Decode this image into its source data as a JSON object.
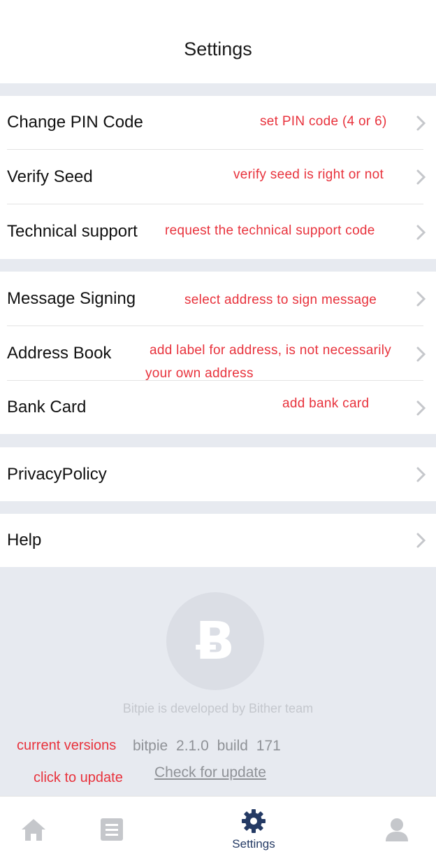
{
  "header": {
    "title": "Settings"
  },
  "groups": [
    {
      "rows": [
        {
          "label": "Change PIN Code",
          "hint": "set PIN code (4 or 6)"
        },
        {
          "label": "Verify Seed",
          "hint": "verify seed is right or not"
        },
        {
          "label": "Technical support",
          "hint": "request the technical support code"
        }
      ]
    },
    {
      "rows": [
        {
          "label": "Message Signing",
          "hint": "select address to sign message"
        },
        {
          "label": "Address Book",
          "hint": "add label for address, is not necessarily",
          "hint2": "your own address"
        },
        {
          "label": "Bank Card",
          "hint": "add bank card"
        }
      ]
    },
    {
      "rows": [
        {
          "label": "PrivacyPolicy"
        }
      ]
    },
    {
      "rows": [
        {
          "label": "Help"
        }
      ]
    }
  ],
  "footer": {
    "logo_glyph": "Ƀ",
    "developed_by": "Bitpie is developed by Bither team",
    "current_versions_label": "current versions",
    "version_text": "bitpie  2.1.0  build  171",
    "click_to_update_label": "click to update",
    "check_update_link": "Check for update"
  },
  "tabbar": {
    "items": [
      {
        "icon": "home-icon",
        "label": ""
      },
      {
        "icon": "list-icon",
        "label": ""
      },
      {
        "icon": "gear-icon",
        "label": "Settings",
        "active": true
      },
      {
        "icon": "user-icon",
        "label": ""
      }
    ]
  },
  "colors": {
    "annotation": "#e8323c",
    "background": "#e7eaf0",
    "active_tab": "#243a64",
    "inactive_tab": "#c5c7cb"
  }
}
